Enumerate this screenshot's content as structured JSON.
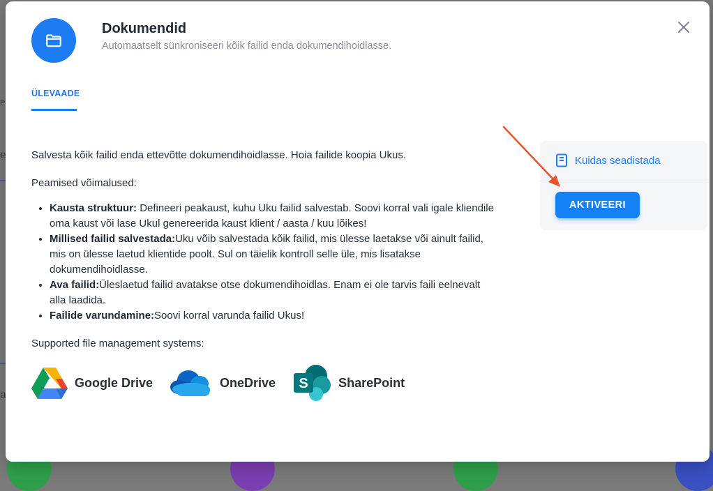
{
  "background": {
    "fragments": [
      "P",
      "e",
      "a"
    ]
  },
  "modal": {
    "title": "Dokumendid",
    "subtitle": "Automaatselt sünkroniseeri kõik failid enda dokumendihoidlasse.",
    "app_icon": "folder-icon",
    "close_icon": "close-icon"
  },
  "tabs": [
    {
      "label": "ÜLEVAADE",
      "active": true
    }
  ],
  "content": {
    "intro": "Salvesta kõik failid enda ettevõtte dokumendihoidlasse. Hoia failide koopia Ukus.",
    "features_label": "Peamised võimalused:",
    "features": [
      {
        "title": "Kausta struktuur:",
        "text": " Defineeri peakaust, kuhu Uku failid salvestab. Soovi korral vali igale kliendile oma kaust või lase Ukul genereerida kaust klient / aasta / kuu lõikes!"
      },
      {
        "title": "Millised failid salvestada:",
        "text": "Uku võib salvestada kõik failid, mis ülesse laetakse või ainult failid, mis on ülesse laetud klientide poolt. Sul on täielik kontroll selle üle, mis lisatakse dokumendihoidlasse."
      },
      {
        "title": "Ava failid:",
        "text": "Üleslaetud failid avatakse otse dokumendihoidlas. Enam ei ole tarvis faili eelnevalt alla laadida."
      },
      {
        "title": "Failide varundamine:",
        "text": "Soovi korral varunda failid Ukus!"
      }
    ],
    "systems_label": "Supported file management systems:",
    "systems": [
      {
        "name": "Google Drive",
        "icon": "google-drive-icon"
      },
      {
        "name": "OneDrive",
        "icon": "onedrive-icon"
      },
      {
        "name": "SharePoint",
        "icon": "sharepoint-icon"
      }
    ]
  },
  "sidebar": {
    "guide_label": "Kuidas seadistada",
    "guide_icon": "book-icon",
    "activate_label": "AKTIVEERI"
  },
  "colors": {
    "accent": "#1e7cf2",
    "annotation_arrow": "#e8542a"
  }
}
